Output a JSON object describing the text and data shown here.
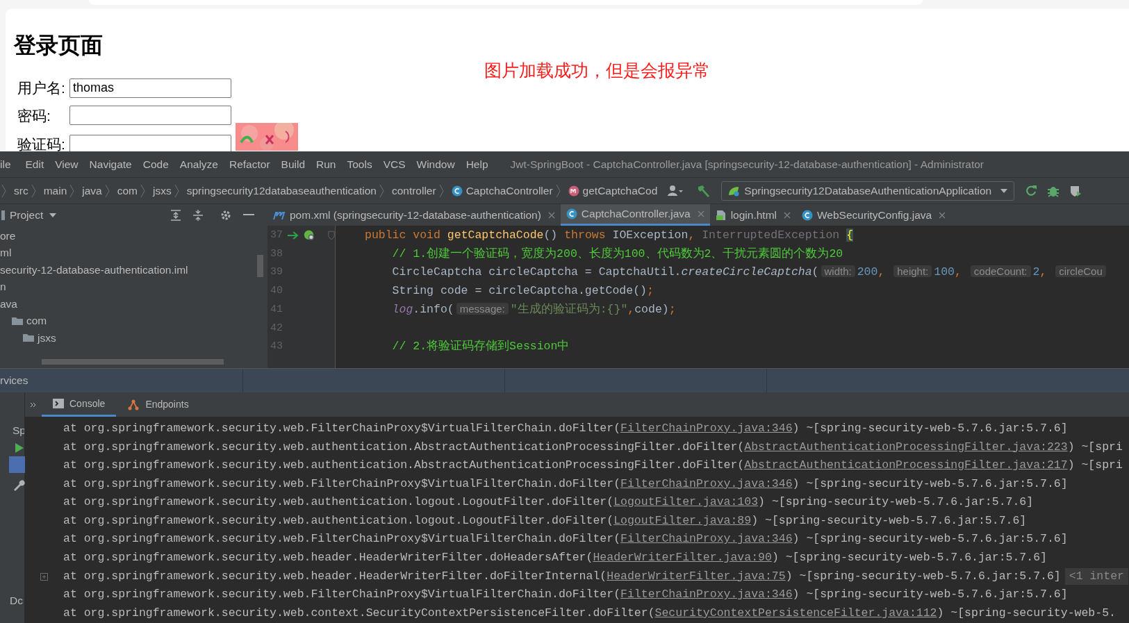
{
  "browser": {
    "heading": "登录页面",
    "note": "图片加载成功，但是会报异常",
    "fields": [
      {
        "label": "用户名:",
        "value": "thomas"
      },
      {
        "label": "密码:"
      },
      {
        "label": "验证码:"
      }
    ]
  },
  "ide": {
    "menu": [
      "ile",
      "Edit",
      "View",
      "Navigate",
      "Code",
      "Analyze",
      "Refactor",
      "Build",
      "Run",
      "Tools",
      "VCS",
      "Window",
      "Help"
    ],
    "title": "Jwt-SpringBoot - CaptchaController.java [springsecurity-12-database-authentication] - Administrator",
    "breadcrumb": [
      {
        "label": "src"
      },
      {
        "label": "main"
      },
      {
        "label": "java"
      },
      {
        "label": "com"
      },
      {
        "label": "jsxs"
      },
      {
        "label": "springsecurity12databaseauthentication"
      },
      {
        "label": "controller"
      },
      {
        "label": "CaptchaController",
        "kind": "class"
      },
      {
        "label": "getCaptchaCod",
        "kind": "method"
      }
    ],
    "run_config": "Springsecurity12DatabaseAuthenticationApplication",
    "project_panel": {
      "title": "Project",
      "tree": [
        {
          "label": "ore"
        },
        {
          "label": "ml"
        },
        {
          "label": "security-12-database-authentication.iml"
        },
        {
          "label": "n"
        },
        {
          "label": "ava",
          "children": [
            {
              "label": "com",
              "kind": "folder",
              "children": [
                {
                  "label": "jsxs",
                  "kind": "folder"
                }
              ]
            }
          ]
        }
      ]
    },
    "editor_tabs": [
      {
        "label": "pom.xml (springsecurity-12-database-authentication)",
        "kind": "maven",
        "selected": false
      },
      {
        "label": "CaptchaController.java",
        "kind": "class",
        "selected": true
      },
      {
        "label": "login.html",
        "kind": "html",
        "selected": false
      },
      {
        "label": "WebSecurityConfig.java",
        "kind": "class",
        "selected": false
      }
    ],
    "code": [
      {
        "number": "37",
        "run_icons": true,
        "segments": [
          {
            "kind": "keyword",
            "text": "public void "
          },
          {
            "kind": "method",
            "text": "getCaptchaCode"
          },
          {
            "kind": "plain",
            "text": "() "
          },
          {
            "kind": "keyword",
            "text": "throws "
          },
          {
            "kind": "plain",
            "text": "IOException"
          },
          {
            "kind": "keyword",
            "text": ", "
          },
          {
            "kind": "unused",
            "text": "InterruptedException "
          },
          {
            "kind": "brace",
            "text": "{"
          }
        ],
        "children": [
          {
            "number": "38",
            "segments": [
              {
                "kind": "comment",
                "text": "// 1.创建一个验证码，宽度为200、长度为100、代码数为2、干扰元素圆的个数为20"
              }
            ]
          },
          {
            "number": "39",
            "segments": [
              {
                "kind": "plain",
                "text": "CircleCaptcha circleCaptcha = CaptchaUtil."
              },
              {
                "kind": "italic",
                "text": "createCircleCaptcha"
              },
              {
                "kind": "plain",
                "text": "("
              },
              {
                "kind": "hint",
                "text": "width:"
              },
              {
                "kind": "number",
                "text": "200"
              },
              {
                "kind": "keyword",
                "text": ", "
              },
              {
                "kind": "hint",
                "text": "height:"
              },
              {
                "kind": "number",
                "text": "100"
              },
              {
                "kind": "keyword",
                "text": ", "
              },
              {
                "kind": "hint",
                "text": "codeCount:"
              },
              {
                "kind": "number",
                "text": "2"
              },
              {
                "kind": "keyword",
                "text": ", "
              },
              {
                "kind": "hint",
                "text": "circleCou"
              }
            ]
          },
          {
            "number": "40",
            "segments": [
              {
                "kind": "plain",
                "text": "String code = circleCaptcha.getCode()"
              },
              {
                "kind": "keyword",
                "text": ";"
              }
            ]
          },
          {
            "number": "41",
            "segments": [
              {
                "kind": "field",
                "text": "log"
              },
              {
                "kind": "plain",
                "text": ".info("
              },
              {
                "kind": "hint",
                "text": "message:"
              },
              {
                "kind": "string",
                "text": "\"生成的验证码为:{}\""
              },
              {
                "kind": "keyword",
                "text": ","
              },
              {
                "kind": "plain",
                "text": "code)"
              },
              {
                "kind": "keyword",
                "text": ";"
              }
            ]
          },
          {
            "number": "42"
          },
          {
            "number": "43",
            "segments": [
              {
                "kind": "comment",
                "text": "// 2.将验证码存储到Session中"
              }
            ]
          }
        ]
      }
    ],
    "services_title": "rvices",
    "services_side": [
      "Sp",
      "Dc"
    ],
    "console_tabs": [
      {
        "label": "Console",
        "kind": "console",
        "selected": true
      },
      {
        "label": "Endpoints",
        "kind": "endpoints",
        "selected": false
      }
    ],
    "console": [
      {
        "prefix": "at org.springframework.security.web.FilterChainProxy$VirtualFilterChain.doFilter(",
        "link": "FilterChainProxy.java:346",
        "suffix": ") ~[spring-security-web-5.7.6.jar:5.7.6]"
      },
      {
        "prefix": "at org.springframework.security.web.authentication.AbstractAuthenticationProcessingFilter.doFilter(",
        "link": "AbstractAuthenticationProcessingFilter.java:223",
        "suffix": ") ~[spri"
      },
      {
        "prefix": "at org.springframework.security.web.authentication.AbstractAuthenticationProcessingFilter.doFilter(",
        "link": "AbstractAuthenticationProcessingFilter.java:217",
        "suffix": ") ~[spri"
      },
      {
        "prefix": "at org.springframework.security.web.FilterChainProxy$VirtualFilterChain.doFilter(",
        "link": "FilterChainProxy.java:346",
        "suffix": ") ~[spring-security-web-5.7.6.jar:5.7.6]"
      },
      {
        "prefix": "at org.springframework.security.web.authentication.logout.LogoutFilter.doFilter(",
        "link": "LogoutFilter.java:103",
        "suffix": ") ~[spring-security-web-5.7.6.jar:5.7.6]"
      },
      {
        "prefix": "at org.springframework.security.web.authentication.logout.LogoutFilter.doFilter(",
        "link": "LogoutFilter.java:89",
        "suffix": ") ~[spring-security-web-5.7.6.jar:5.7.6]"
      },
      {
        "prefix": "at org.springframework.security.web.FilterChainProxy$VirtualFilterChain.doFilter(",
        "link": "FilterChainProxy.java:346",
        "suffix": ") ~[spring-security-web-5.7.6.jar:5.7.6]"
      },
      {
        "prefix": "at org.springframework.security.web.header.HeaderWriterFilter.doHeadersAfter(",
        "link": "HeaderWriterFilter.java:90",
        "suffix": ") ~[spring-security-web-5.7.6.jar:5.7.6]"
      },
      {
        "prefix": "at org.springframework.security.web.header.HeaderWriterFilter.doFilterInternal(",
        "link": "HeaderWriterFilter.java:75",
        "suffix": ") ~[spring-security-web-5.7.6.jar:5.7.6]",
        "fold": "<1 inter"
      },
      {
        "prefix": "at org.springframework.security.web.FilterChainProxy$VirtualFilterChain.doFilter(",
        "link": "FilterChainProxy.java:346",
        "suffix": ") ~[spring-security-web-5.7.6.jar:5.7.6]"
      },
      {
        "prefix": "at org.springframework.security.web.context.SecurityContextPersistenceFilter.doFilter(",
        "link": "SecurityContextPersistenceFilter.java:112",
        "suffix": ") ~[spring-security-web-5."
      }
    ]
  }
}
